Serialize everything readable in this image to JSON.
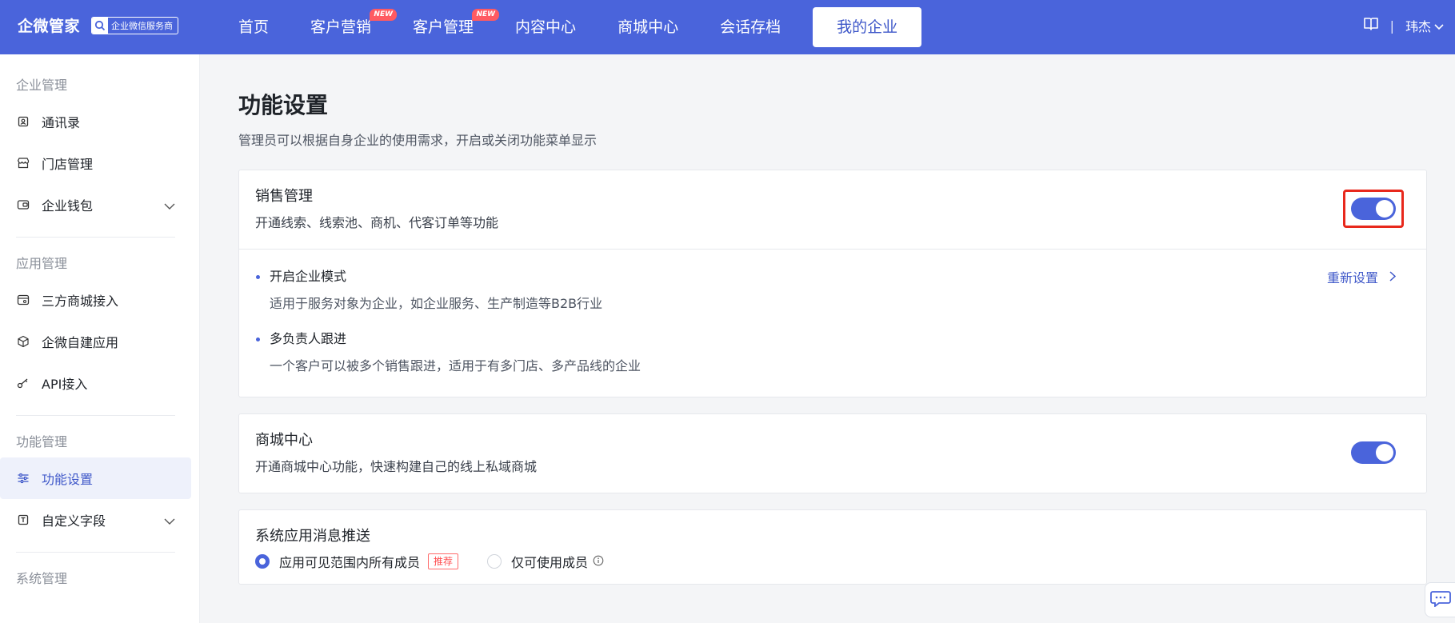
{
  "brand": {
    "name": "企微管家",
    "badge": "企业微信服务商"
  },
  "nav": {
    "items": [
      {
        "label": "首页",
        "tag": ""
      },
      {
        "label": "客户营销",
        "tag": "NEW"
      },
      {
        "label": "客户管理",
        "tag": "NEW"
      },
      {
        "label": "内容中心",
        "tag": ""
      },
      {
        "label": "商城中心",
        "tag": ""
      },
      {
        "label": "会话存档",
        "tag": ""
      },
      {
        "label": "我的企业",
        "tag": "",
        "active": true
      }
    ]
  },
  "header": {
    "separator": "|",
    "user_name": "玮杰"
  },
  "sidebar": {
    "groups": [
      {
        "title": "企业管理",
        "items": [
          {
            "label": "通讯录",
            "icon": "contacts-icon"
          },
          {
            "label": "门店管理",
            "icon": "store-icon"
          },
          {
            "label": "企业钱包",
            "icon": "wallet-icon",
            "expandable": true
          }
        ]
      },
      {
        "title": "应用管理",
        "items": [
          {
            "label": "三方商城接入",
            "icon": "mall-link-icon"
          },
          {
            "label": "企微自建应用",
            "icon": "cube-icon"
          },
          {
            "label": "API接入",
            "icon": "key-icon"
          }
        ]
      },
      {
        "title": "功能管理",
        "items": [
          {
            "label": "功能设置",
            "icon": "sliders-icon",
            "active": true
          },
          {
            "label": "自定义字段",
            "icon": "text-field-icon",
            "expandable": true
          }
        ]
      },
      {
        "title": "系统管理"
      }
    ]
  },
  "page": {
    "title": "功能设置",
    "description": "管理员可以根据自身企业的使用需求，开启或关闭功能菜单显示"
  },
  "sales": {
    "title": "销售管理",
    "subtitle": "开通线索、线索池、商机、代客订单等功能",
    "enabled": true,
    "reset_label": "重新设置",
    "options": [
      {
        "title": "开启企业模式",
        "desc": "适用于服务对象为企业，如企业服务、生产制造等B2B行业"
      },
      {
        "title": "多负责人跟进",
        "desc": "一个客户可以被多个销售跟进，适用于有多门店、多产品线的企业"
      }
    ]
  },
  "mall": {
    "title": "商城中心",
    "subtitle": "开通商城中心功能，快速构建自己的线上私域商城",
    "enabled": true
  },
  "push": {
    "title": "系统应用消息推送",
    "option_all": "应用可见范围内所有成员",
    "recommend_tag": "推荐",
    "option_members": "仅可使用成员",
    "selected": "all"
  },
  "colors": {
    "accent": "#4a64db",
    "highlight": "#e8281c",
    "tag_red": "#ff5a62"
  }
}
